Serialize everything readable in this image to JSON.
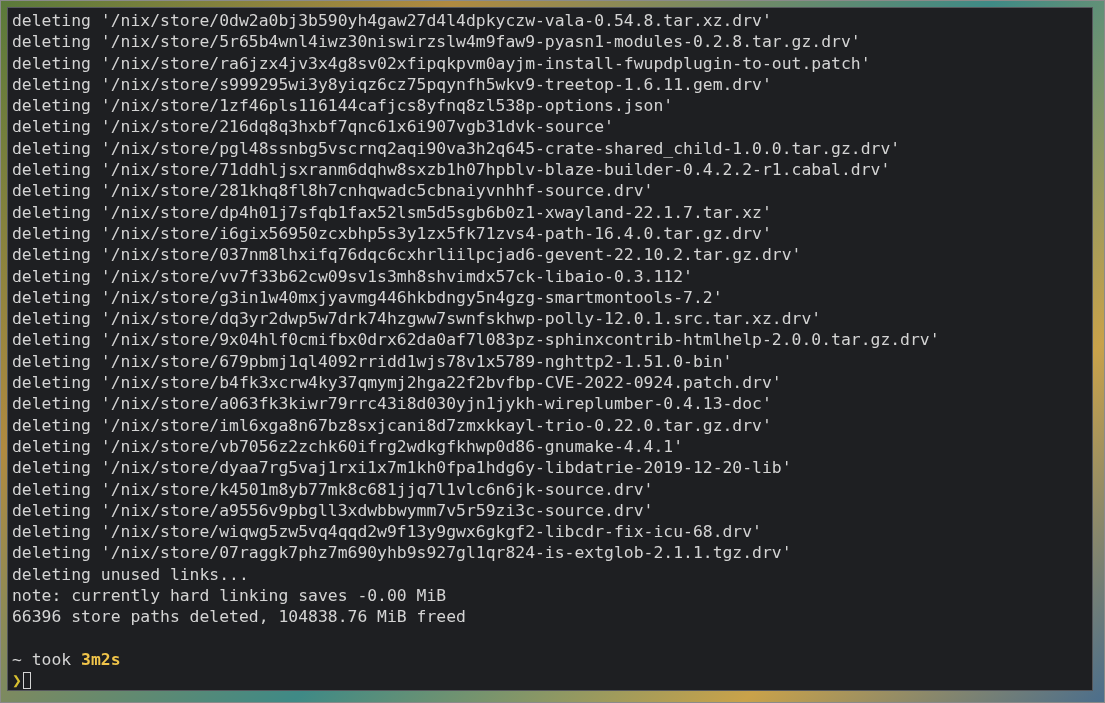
{
  "terminal": {
    "lines": [
      "deleting '/nix/store/0dw2a0bj3b590yh4gaw27d4l4dpkyczw-vala-0.54.8.tar.xz.drv'",
      "deleting '/nix/store/5r65b4wnl4iwz30niswirzslw4m9faw9-pyasn1-modules-0.2.8.tar.gz.drv'",
      "deleting '/nix/store/ra6jzx4jv3x4g8sv02xfipqkpvm0ayjm-install-fwupdplugin-to-out.patch'",
      "deleting '/nix/store/s999295wi3y8yiqz6cz75pqynfh5wkv9-treetop-1.6.11.gem.drv'",
      "deleting '/nix/store/1zf46pls116144cafjcs8yfnq8zl538p-options.json'",
      "deleting '/nix/store/216dq8q3hxbf7qnc61x6i907vgb31dvk-source'",
      "deleting '/nix/store/pgl48ssnbg5vscrnq2aqi90va3h2q645-crate-shared_child-1.0.0.tar.gz.drv'",
      "deleting '/nix/store/71ddhljsxranm6dqhw8sxzb1h07hpblv-blaze-builder-0.4.2.2-r1.cabal.drv'",
      "deleting '/nix/store/281khq8fl8h7cnhqwadc5cbnaiyvnhhf-source.drv'",
      "deleting '/nix/store/dp4h01j7sfqb1fax52lsm5d5sgb6b0z1-xwayland-22.1.7.tar.xz'",
      "deleting '/nix/store/i6gix56950zcxbhp5s3y1zx5fk71zvs4-path-16.4.0.tar.gz.drv'",
      "deleting '/nix/store/037nm8lhxifq76dqc6cxhrliilpcjad6-gevent-22.10.2.tar.gz.drv'",
      "deleting '/nix/store/vv7f33b62cw09sv1s3mh8shvimdx57ck-libaio-0.3.112'",
      "deleting '/nix/store/g3in1w40mxjyavmg446hkbdngy5n4gzg-smartmontools-7.2'",
      "deleting '/nix/store/dq3yr2dwp5w7drk74hzgww7swnfskhwp-polly-12.0.1.src.tar.xz.drv'",
      "deleting '/nix/store/9x04hlf0cmifbx0drx62da0af7l083pz-sphinxcontrib-htmlhelp-2.0.0.tar.gz.drv'",
      "deleting '/nix/store/679pbmj1ql4092rridd1wjs78v1x5789-nghttp2-1.51.0-bin'",
      "deleting '/nix/store/b4fk3xcrw4ky37qmymj2hga22f2bvfbp-CVE-2022-0924.patch.drv'",
      "deleting '/nix/store/a063fk3kiwr79rrc43i8d030yjn1jykh-wireplumber-0.4.13-doc'",
      "deleting '/nix/store/iml6xga8n67bz8sxjcani8d7zmxkkayl-trio-0.22.0.tar.gz.drv'",
      "deleting '/nix/store/vb7056z2zchk60ifrg2wdkgfkhwp0d86-gnumake-4.4.1'",
      "deleting '/nix/store/dyaa7rg5vaj1rxi1x7m1kh0fpa1hdg6y-libdatrie-2019-12-20-lib'",
      "deleting '/nix/store/k4501m8yb77mk8c681jjq7l1vlc6n6jk-source.drv'",
      "deleting '/nix/store/a9556v9pbgll3xdwbbwymm7v5r59zi3c-source.drv'",
      "deleting '/nix/store/wiqwg5zw5vq4qqd2w9f13y9gwx6gkgf2-libcdr-fix-icu-68.drv'",
      "deleting '/nix/store/07raggk7phz7m690yhb9s927gl1qr824-is-extglob-2.1.1.tgz.drv'",
      "deleting unused links...",
      "note: currently hard linking saves -0.00 MiB",
      "66396 store paths deleted, 104838.76 MiB freed"
    ],
    "prompt": {
      "prefix": "~ took",
      "duration": "3m2s",
      "symbol": "❯"
    }
  }
}
